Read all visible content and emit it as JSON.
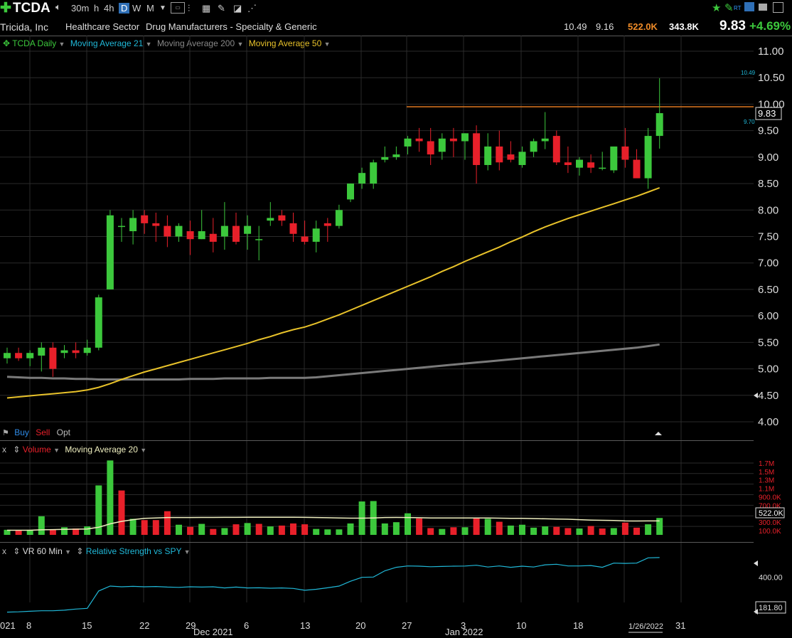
{
  "toolbar": {
    "symbol": "TCDA",
    "timeframes": [
      "30m",
      "h",
      "4h",
      "D",
      "W",
      "M"
    ],
    "active_timeframe": "D",
    "rt_label": "RT"
  },
  "info": {
    "company": "Tricida, Inc",
    "sector": "Healthcare Sector",
    "industry": "Drug Manufacturers - Specialty & Generic",
    "high": "10.49",
    "low": "9.16",
    "volume": "522.0K",
    "avg_volume": "343.8K",
    "last": "9.83",
    "change": "+4.69%"
  },
  "price_legend": {
    "series": "TCDA Daily",
    "ma21": "Moving Average 21",
    "ma200": "Moving Average 200",
    "ma50": "Moving Average 50"
  },
  "order_bar": {
    "buy": "Buy",
    "sell": "Sell",
    "opt": "Opt"
  },
  "volume_legend": {
    "close": "x",
    "volume": "Volume",
    "ma": "Moving Average 20"
  },
  "rs_legend": {
    "close": "x",
    "vr": "VR 60 Min",
    "rs": "Relative Strength vs SPY"
  },
  "x_axis_labels": [
    "021",
    "8",
    "15",
    "22",
    "29",
    "Dec 2021",
    "6",
    "13",
    "20",
    "27",
    "3",
    "Jan 2022",
    "10",
    "18",
    "1/26/2022",
    "31"
  ],
  "colors": {
    "up": "#3cc83c",
    "down": "#e8202a",
    "ma50": "#e8c22a",
    "ma200": "#7a7a7a",
    "resistance": "#e07820",
    "rs": "#20b8d8",
    "vol_ma": "#f0f0c0"
  },
  "chart_data": [
    {
      "type": "candlestick",
      "title": "TCDA Daily",
      "ylim": [
        3.8,
        11.1
      ],
      "yticks": [
        "11.00",
        "10.50",
        "10.00",
        "9.50",
        "9.00",
        "8.50",
        "8.00",
        "7.50",
        "7.00",
        "6.50",
        "6.00",
        "5.50",
        "5.00",
        "4.50",
        "4.00"
      ],
      "price_tags": [
        "10.49",
        "9.83",
        "9.70"
      ],
      "dates": [
        "2021-11-03",
        "2021-11-04",
        "2021-11-05",
        "2021-11-08",
        "2021-11-09",
        "2021-11-10",
        "2021-11-11",
        "2021-11-12",
        "2021-11-15",
        "2021-11-16",
        "2021-11-17",
        "2021-11-18",
        "2021-11-19",
        "2021-11-22",
        "2021-11-23",
        "2021-11-24",
        "2021-11-26",
        "2021-11-29",
        "2021-11-30",
        "2021-12-01",
        "2021-12-02",
        "2021-12-03",
        "2021-12-06",
        "2021-12-07",
        "2021-12-08",
        "2021-12-09",
        "2021-12-10",
        "2021-12-13",
        "2021-12-14",
        "2021-12-15",
        "2021-12-16",
        "2021-12-17",
        "2021-12-20",
        "2021-12-21",
        "2021-12-22",
        "2021-12-23",
        "2021-12-27",
        "2021-12-28",
        "2021-12-29",
        "2021-12-30",
        "2021-12-31",
        "2022-01-03",
        "2022-01-04",
        "2022-01-05",
        "2022-01-06",
        "2022-01-07",
        "2022-01-10",
        "2022-01-11",
        "2022-01-12",
        "2022-01-13",
        "2022-01-14",
        "2022-01-18",
        "2022-01-19",
        "2022-01-20",
        "2022-01-21",
        "2022-01-24",
        "2022-01-25",
        "2022-01-26"
      ],
      "open": [
        5.2,
        5.3,
        5.2,
        5.25,
        5.4,
        5.3,
        5.35,
        5.3,
        5.4,
        6.5,
        7.7,
        7.6,
        7.9,
        7.75,
        7.7,
        7.5,
        7.6,
        7.45,
        7.55,
        7.5,
        7.7,
        7.55,
        7.45,
        7.8,
        7.9,
        7.75,
        7.5,
        7.4,
        7.75,
        7.7,
        8.2,
        8.5,
        8.5,
        8.95,
        9.0,
        9.2,
        9.35,
        9.3,
        9.1,
        9.35,
        9.3,
        9.45,
        8.85,
        9.2,
        9.05,
        8.85,
        9.1,
        9.3,
        9.4,
        8.9,
        8.8,
        8.9,
        8.8,
        8.75,
        9.2,
        8.95,
        8.6,
        9.4
      ],
      "high": [
        5.4,
        5.4,
        5.35,
        5.5,
        5.5,
        5.45,
        5.5,
        5.55,
        6.4,
        8.0,
        7.85,
        8.0,
        8.0,
        7.95,
        7.9,
        7.75,
        7.8,
        8.0,
        7.85,
        8.15,
        7.95,
        7.9,
        7.7,
        8.15,
        8.0,
        7.95,
        7.8,
        7.8,
        7.85,
        8.1,
        8.5,
        8.8,
        8.95,
        9.2,
        9.2,
        9.4,
        9.55,
        9.55,
        9.45,
        9.55,
        9.45,
        9.6,
        9.45,
        9.5,
        9.3,
        9.2,
        9.35,
        9.85,
        9.5,
        9.2,
        9.0,
        9.05,
        9.1,
        9.15,
        9.55,
        9.15,
        9.55,
        10.49
      ],
      "low": [
        5.1,
        5.15,
        5.05,
        4.95,
        4.85,
        5.2,
        5.2,
        5.25,
        5.35,
        6.5,
        7.4,
        7.35,
        7.55,
        7.4,
        7.3,
        7.4,
        7.15,
        7.45,
        7.2,
        7.25,
        7.35,
        7.25,
        7.05,
        7.7,
        7.7,
        7.4,
        7.35,
        7.2,
        7.4,
        7.65,
        8.15,
        8.4,
        8.4,
        8.9,
        8.95,
        9.05,
        9.1,
        8.85,
        8.95,
        9.0,
        8.95,
        8.5,
        8.75,
        8.75,
        8.9,
        8.8,
        9.0,
        9.15,
        8.85,
        8.7,
        8.65,
        8.7,
        8.75,
        8.7,
        8.8,
        8.75,
        8.4,
        9.16
      ],
      "close": [
        5.3,
        5.2,
        5.3,
        5.4,
        5.0,
        5.35,
        5.3,
        5.4,
        6.35,
        7.9,
        7.7,
        7.85,
        7.75,
        7.7,
        7.5,
        7.7,
        7.45,
        7.6,
        7.4,
        7.7,
        7.4,
        7.7,
        7.45,
        7.85,
        7.8,
        7.55,
        7.4,
        7.65,
        7.7,
        8.0,
        8.5,
        8.7,
        8.9,
        9.0,
        9.05,
        9.35,
        9.3,
        9.05,
        9.35,
        9.3,
        9.45,
        8.85,
        9.2,
        8.9,
        8.95,
        9.1,
        9.3,
        9.35,
        8.9,
        8.85,
        8.95,
        8.8,
        8.8,
        9.2,
        8.95,
        8.6,
        9.4,
        9.83
      ],
      "ma50": [
        4.45,
        4.47,
        4.49,
        4.51,
        4.53,
        4.55,
        4.57,
        4.6,
        4.65,
        4.72,
        4.8,
        4.87,
        4.94,
        5.0,
        5.06,
        5.12,
        5.18,
        5.24,
        5.3,
        5.36,
        5.42,
        5.48,
        5.55,
        5.61,
        5.68,
        5.74,
        5.79,
        5.86,
        5.94,
        6.02,
        6.11,
        6.2,
        6.29,
        6.38,
        6.47,
        6.56,
        6.65,
        6.74,
        6.84,
        6.93,
        7.03,
        7.12,
        7.21,
        7.3,
        7.4,
        7.49,
        7.59,
        7.68,
        7.76,
        7.84,
        7.91,
        7.98,
        8.05,
        8.12,
        8.19,
        8.26,
        8.34,
        8.42
      ],
      "ma200": [
        4.85,
        4.84,
        4.83,
        4.83,
        4.82,
        4.82,
        4.81,
        4.81,
        4.8,
        4.8,
        4.8,
        4.8,
        4.8,
        4.8,
        4.8,
        4.8,
        4.81,
        4.81,
        4.81,
        4.82,
        4.82,
        4.82,
        4.82,
        4.83,
        4.83,
        4.83,
        4.83,
        4.84,
        4.86,
        4.88,
        4.9,
        4.92,
        4.94,
        4.96,
        4.98,
        5.0,
        5.02,
        5.04,
        5.06,
        5.08,
        5.1,
        5.12,
        5.14,
        5.16,
        5.18,
        5.2,
        5.22,
        5.24,
        5.26,
        5.28,
        5.3,
        5.32,
        5.34,
        5.36,
        5.38,
        5.4,
        5.43,
        5.46
      ],
      "resistance": 9.95
    },
    {
      "type": "bar",
      "title": "Volume",
      "ylim": [
        0,
        1800
      ],
      "yticks": [
        "1.7M",
        "1.5M",
        "1.3M",
        "1.1M",
        "900.0K",
        "700.0K",
        "522.0K",
        "300.0K",
        "100.0K"
      ],
      "values": [
        120,
        100,
        120,
        440,
        130,
        180,
        150,
        200,
        1170,
        1760,
        1050,
        380,
        350,
        350,
        560,
        240,
        190,
        260,
        140,
        160,
        250,
        280,
        260,
        200,
        220,
        270,
        250,
        140,
        130,
        130,
        270,
        790,
        800,
        270,
        300,
        510,
        390,
        160,
        140,
        180,
        180,
        400,
        380,
        310,
        220,
        240,
        170,
        200,
        190,
        160,
        150,
        210,
        150,
        160,
        290,
        170,
        250,
        400
      ],
      "up": [
        true,
        false,
        true,
        true,
        false,
        true,
        false,
        true,
        true,
        true,
        false,
        true,
        false,
        false,
        false,
        true,
        false,
        true,
        false,
        true,
        false,
        true,
        false,
        true,
        false,
        false,
        false,
        true,
        true,
        true,
        true,
        true,
        true,
        true,
        true,
        true,
        false,
        false,
        true,
        false,
        true,
        false,
        true,
        false,
        true,
        true,
        true,
        true,
        false,
        false,
        true,
        false,
        false,
        true,
        false,
        false,
        true,
        true
      ],
      "ma20": [
        110,
        110,
        110,
        120,
        125,
        130,
        135,
        140,
        180,
        260,
        320,
        360,
        390,
        400,
        410,
        410,
        410,
        412,
        412,
        414,
        414,
        415,
        415,
        415,
        416,
        415,
        414,
        410,
        405,
        400,
        395,
        395,
        400,
        410,
        412,
        410,
        405,
        400,
        400,
        398,
        398,
        400,
        398,
        396,
        390,
        390,
        385,
        380,
        375,
        370,
        360,
        350,
        345,
        340,
        330,
        328,
        330,
        330
      ]
    },
    {
      "type": "line",
      "title": "Relative Strength vs SPY",
      "ylim": [
        100,
        560
      ],
      "yticks": [
        "400.00",
        "181.80"
      ],
      "values": [
        148,
        150,
        154,
        158,
        158,
        162,
        170,
        175,
        300,
        335,
        330,
        333,
        330,
        332,
        328,
        326,
        330,
        328,
        330,
        322,
        328,
        322,
        323,
        320,
        322,
        318,
        305,
        312,
        323,
        335,
        370,
        398,
        400,
        445,
        470,
        480,
        478,
        474,
        476,
        478,
        479,
        485,
        472,
        480,
        470,
        478,
        472,
        488,
        492,
        480,
        480,
        483,
        470,
        500,
        498,
        500,
        538,
        540
      ]
    }
  ]
}
